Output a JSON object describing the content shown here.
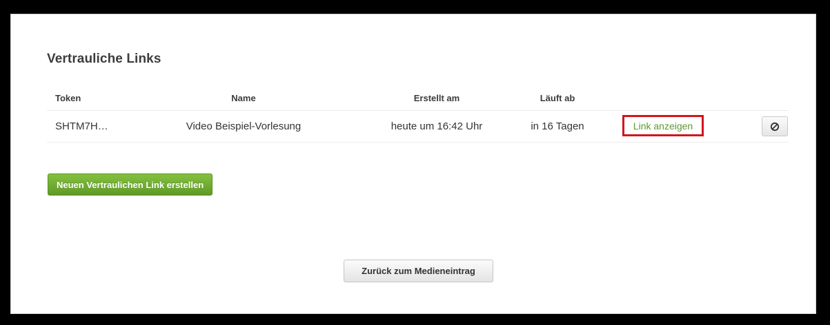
{
  "section": {
    "title": "Vertrauliche Links"
  },
  "table": {
    "headers": {
      "token": "Token",
      "name": "Name",
      "created": "Erstellt am",
      "expires": "Läuft ab"
    },
    "rows": [
      {
        "token": "SHTM7H…",
        "name": "Video Beispiel-Vorlesung",
        "created": "heute um 16:42 Uhr",
        "expires": "in 16 Tagen",
        "action_label": "Link anzeigen",
        "revoke_icon": "block-icon"
      }
    ]
  },
  "actions": {
    "create_label": "Neuen Vertraulichen Link erstellen",
    "back_label": "Zurück zum Medieneintrag"
  },
  "colors": {
    "accent_green": "#6aab2e",
    "link_green": "#5c9a2b",
    "highlight_red": "#d4141c"
  }
}
